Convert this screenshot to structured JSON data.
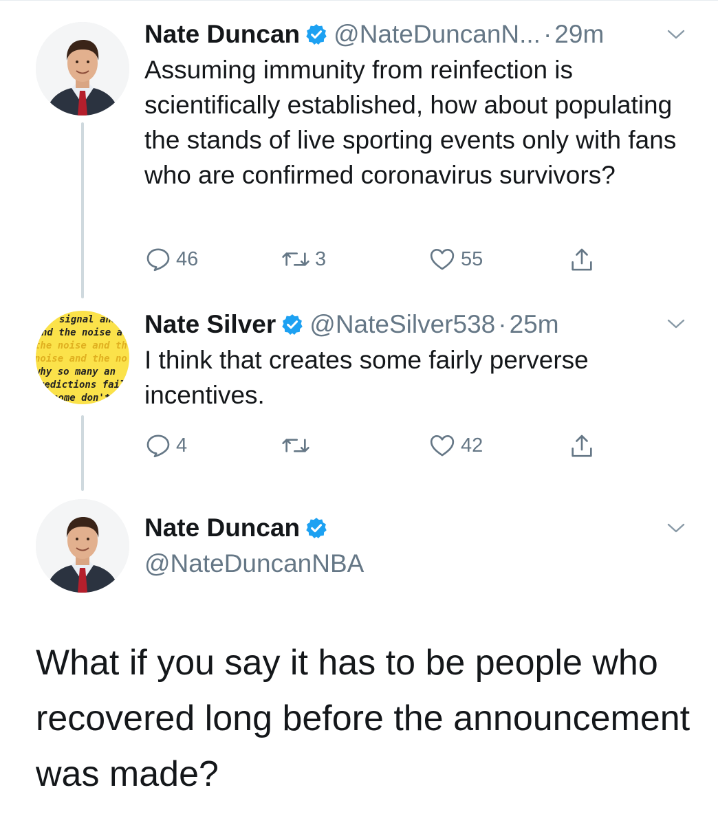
{
  "tweets": [
    {
      "name": "Nate Duncan",
      "handle": "@NateDuncanN...",
      "separator": "·",
      "time": "29m",
      "text": "Assuming immunity from reinfection is scientifically established, how about populating the stands of live sporting events only with fans who are confirmed coronavirus survivors?",
      "replies": "46",
      "retweets": "3",
      "likes": "55"
    },
    {
      "name": "Nate Silver",
      "handle": "@NateSilver538",
      "separator": "·",
      "time": "25m",
      "text": "I think that creates some fairly perverse incentives.",
      "replies": "4",
      "retweets": "",
      "likes": "42",
      "avatar_text": [
        "signal and",
        "nd the noise a",
        "the noise and th",
        "noise and the no",
        "why so many an",
        "redictions fail",
        "some don't"
      ]
    }
  ],
  "reply": {
    "name": "Nate Duncan",
    "handle": "@NateDuncanNBA",
    "text": "What if you say it has to be people who recovered long before the announcement was made?"
  },
  "colors": {
    "text": "#14171a",
    "secondary": "#657786",
    "verified": "#1da1f2",
    "thread_line": "#cfd9de"
  },
  "icons": [
    "verified-badge-icon",
    "chevron-down-icon",
    "reply-icon",
    "retweet-icon",
    "like-icon",
    "share-icon"
  ]
}
